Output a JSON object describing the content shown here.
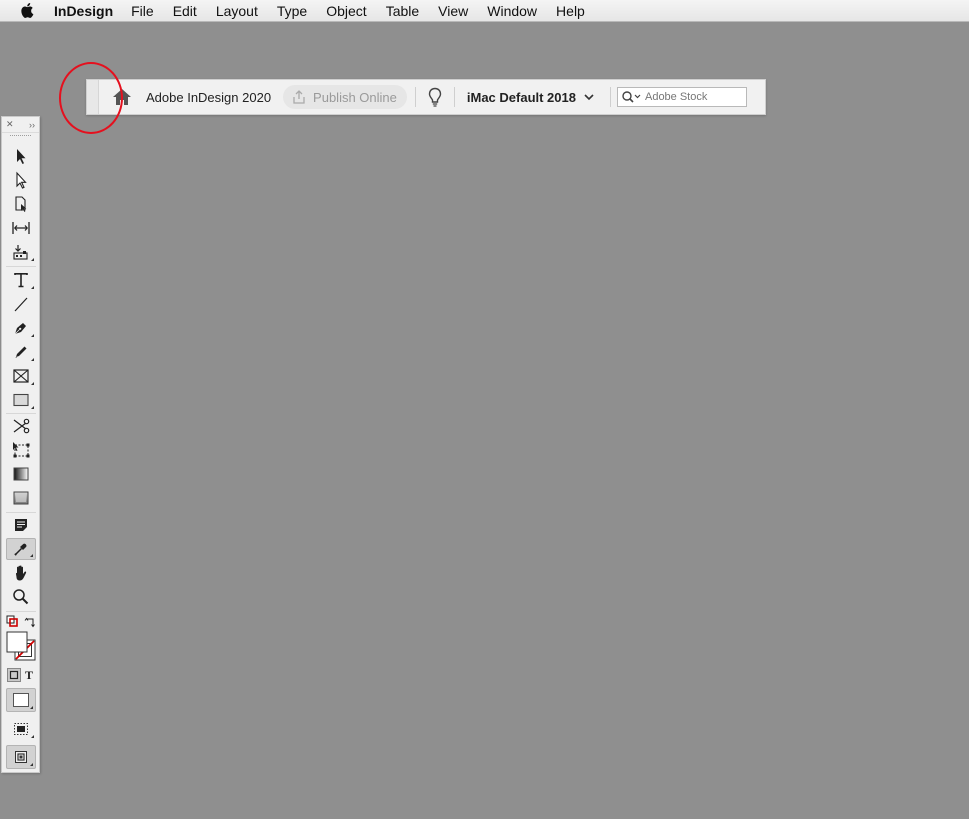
{
  "menubar": {
    "app_name": "InDesign",
    "items": [
      "File",
      "Edit",
      "Layout",
      "Type",
      "Object",
      "Table",
      "View",
      "Window",
      "Help"
    ]
  },
  "appbar": {
    "title": "Adobe InDesign 2020",
    "publish_label": "Publish Online",
    "workspace": "iMac Default 2018",
    "search_placeholder": "Adobe Stock"
  },
  "colors": {
    "background": "#8f8f8f",
    "annotation": "#e5101e"
  },
  "tools": [
    "selection-tool",
    "direct-selection-tool",
    "page-tool",
    "gap-tool",
    "content-collector-tool",
    "type-tool",
    "line-tool",
    "pen-tool",
    "pencil-tool",
    "rectangle-frame-tool",
    "rectangle-tool",
    "scissors-tool",
    "free-transform-tool",
    "gradient-swatch-tool",
    "gradient-feather-tool",
    "note-tool",
    "eyedropper-tool",
    "hand-tool",
    "zoom-tool"
  ]
}
